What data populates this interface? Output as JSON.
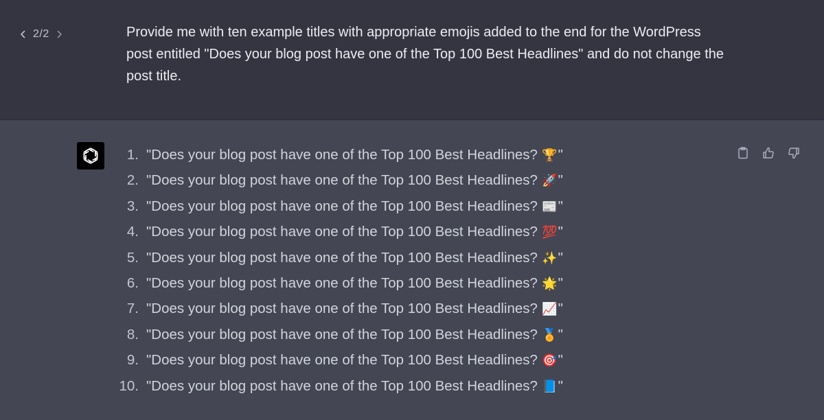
{
  "pager": {
    "current": "2/2"
  },
  "user_message": "Provide me with ten example titles with appropriate emojis added to the end for the WordPress post entitled \"Does your blog post have one of the Top 100 Best Headlines\" and do not change the post title.",
  "assistant": {
    "items": [
      {
        "number": "1.",
        "title": "\"Does your blog post have one of the Top 100 Best Headlines? ",
        "emoji": "🏆",
        "close": "\"",
        "emoji_color": "#e0a21b"
      },
      {
        "number": "2.",
        "title": "\"Does your blog post have one of the Top 100 Best Headlines? ",
        "emoji": "🚀",
        "close": "\"",
        "emoji_color": "#cfd3da"
      },
      {
        "number": "3.",
        "title": "\"Does your blog post have one of the Top 100 Best Headlines? ",
        "emoji": "📰",
        "close": "\"",
        "emoji_color": "#5a5c66"
      },
      {
        "number": "4.",
        "title": "\"Does your blog post have one of the Top 100 Best Headlines? ",
        "emoji": "💯",
        "close": "\"",
        "emoji_color": "#d63a3a"
      },
      {
        "number": "5.",
        "title": "\"Does your blog post have one of the Top 100 Best Headlines? ",
        "emoji": "✨",
        "close": "\"",
        "emoji_color": "#f2c94c"
      },
      {
        "number": "6.",
        "title": "\"Does your blog post have one of the Top 100 Best Headlines? ",
        "emoji": "🌟",
        "close": "\"",
        "emoji_color": "#f5b82e"
      },
      {
        "number": "7.",
        "title": "\"Does your blog post have one of the Top 100 Best Headlines? ",
        "emoji": "📈",
        "close": "\"",
        "emoji_color": "#e25555"
      },
      {
        "number": "8.",
        "title": "\"Does your blog post have one of the Top 100 Best Headlines? ",
        "emoji": "🏅",
        "close": "\"",
        "emoji_color": "#e0a21b"
      },
      {
        "number": "9.",
        "title": "\"Does your blog post have one of the Top 100 Best Headlines? ",
        "emoji": "🎯",
        "close": "\"",
        "emoji_color": "#d63a3a"
      },
      {
        "number": "10.",
        "title": "\"Does your blog post have one of the Top 100 Best Headlines? ",
        "emoji": "📘",
        "close": "\"",
        "emoji_color": "#3b82f6"
      }
    ]
  },
  "icons": {
    "prev": "chevron-left-icon",
    "next": "chevron-right-icon",
    "avatar": "openai-logo-icon",
    "copy": "clipboard-icon",
    "like": "thumbs-up-icon",
    "dislike": "thumbs-down-icon"
  },
  "colors": {
    "user_bg": "#343541",
    "assistant_bg": "#444654",
    "text": "#d1d5db"
  }
}
